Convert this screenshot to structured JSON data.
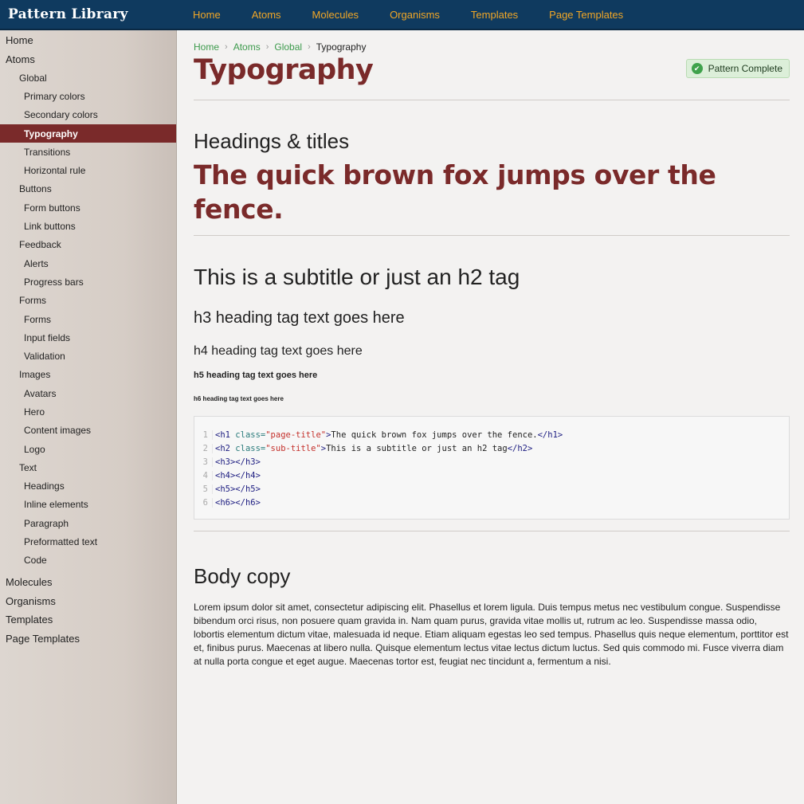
{
  "brand": "Pattern Library",
  "topnav": [
    "Home",
    "Atoms",
    "Molecules",
    "Organisms",
    "Templates",
    "Page Templates"
  ],
  "sidebar": [
    {
      "label": "Home",
      "level": 0
    },
    {
      "label": "Atoms",
      "level": 0
    },
    {
      "label": "Global",
      "level": 1
    },
    {
      "label": "Primary colors",
      "level": 2
    },
    {
      "label": "Secondary colors",
      "level": 2
    },
    {
      "label": "Typography",
      "level": 2,
      "active": true
    },
    {
      "label": "Transitions",
      "level": 2
    },
    {
      "label": "Horizontal rule",
      "level": 2
    },
    {
      "label": "Buttons",
      "level": 1
    },
    {
      "label": "Form buttons",
      "level": 2
    },
    {
      "label": "Link buttons",
      "level": 2
    },
    {
      "label": "Feedback",
      "level": 1
    },
    {
      "label": "Alerts",
      "level": 2
    },
    {
      "label": "Progress bars",
      "level": 2
    },
    {
      "label": "Forms",
      "level": 1
    },
    {
      "label": "Forms",
      "level": 2
    },
    {
      "label": "Input fields",
      "level": 2
    },
    {
      "label": "Validation",
      "level": 2
    },
    {
      "label": "Images",
      "level": 1
    },
    {
      "label": "Avatars",
      "level": 2
    },
    {
      "label": "Hero",
      "level": 2
    },
    {
      "label": "Content images",
      "level": 2
    },
    {
      "label": "Logo",
      "level": 2
    },
    {
      "label": "Text",
      "level": 1
    },
    {
      "label": "Headings",
      "level": 2
    },
    {
      "label": "Inline elements",
      "level": 2
    },
    {
      "label": "Paragraph",
      "level": 2
    },
    {
      "label": "Preformatted text",
      "level": 2
    },
    {
      "label": "Code",
      "level": 2
    },
    {
      "label": "Molecules",
      "level": 0
    },
    {
      "label": "Organisms",
      "level": 0
    },
    {
      "label": "Templates",
      "level": 0
    },
    {
      "label": "Page Templates",
      "level": 0
    }
  ],
  "breadcrumb": {
    "links": [
      "Home",
      "Atoms",
      "Global"
    ],
    "current": "Typography"
  },
  "page_title": "Typography",
  "badge": {
    "label": "Pattern Complete",
    "icon": "check-circle-icon",
    "color": "#3fa24b"
  },
  "headings_section": {
    "title": "Headings & titles",
    "display_line1": "The quick brown fox jumps over the",
    "display_line2": "fence.",
    "h2": "This is a subtitle or just an h2 tag",
    "h3": "h3 heading tag text goes here",
    "h4": "h4 heading tag text goes here",
    "h5": "h5 heading tag text goes here",
    "h6": "h6 heading tag text goes here"
  },
  "code_lines": [
    {
      "n": "1",
      "open": "<h1 ",
      "attr": "class=",
      "str": "\"page-title\"",
      "close": ">",
      "text": "The quick brown fox jumps over the fence.",
      "end": "</h1>"
    },
    {
      "n": "2",
      "open": "<h2 ",
      "attr": "class=",
      "str": "\"sub-title\"",
      "close": ">",
      "text": "This is a subtitle or just an h2 tag",
      "end": "</h2>"
    },
    {
      "n": "3",
      "open": "<h3>",
      "attr": "",
      "str": "",
      "close": "",
      "text": "",
      "end": "</h3>"
    },
    {
      "n": "4",
      "open": "<h4>",
      "attr": "",
      "str": "",
      "close": "",
      "text": "",
      "end": "</h4>"
    },
    {
      "n": "5",
      "open": "<h5>",
      "attr": "",
      "str": "",
      "close": "",
      "text": "",
      "end": "</h5>"
    },
    {
      "n": "6",
      "open": "<h6>",
      "attr": "",
      "str": "",
      "close": "",
      "text": "",
      "end": "</h6>"
    }
  ],
  "body_section": {
    "title": "Body copy",
    "text": "Lorem ipsum dolor sit amet, consectetur adipiscing elit. Phasellus et lorem ligula. Duis tempus metus nec vestibulum congue. Suspendisse bibendum orci risus, non posuere quam gravida in. Nam quam purus, gravida vitae mollis ut, rutrum ac leo. Suspendisse massa odio, lobortis elementum dictum vitae, malesuada id neque. Etiam aliquam egestas leo sed tempus. Phasellus quis neque elementum, porttitor est et, finibus purus. Maecenas at libero nulla. Quisque elementum lectus vitae lectus dictum luctus. Sed quis commodo mi. Fusce viverra diam at nulla porta congue et eget augue. Maecenas tortor est, feugiat nec tincidunt a, fermentum a nisi."
  },
  "colors": {
    "header": "#0f3a5f",
    "nav_link": "#f2a726",
    "accent": "#7a2a2a",
    "link": "#3c9a4c"
  }
}
